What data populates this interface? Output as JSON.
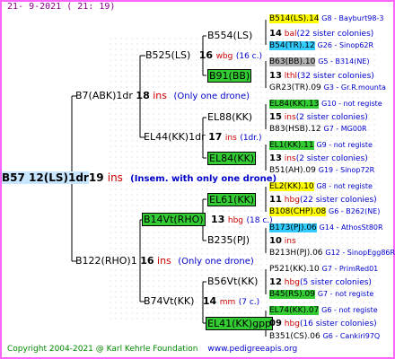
{
  "header": "21-  9-2021 ( 21: 19)",
  "footer": {
    "copyright": "Copyright 2004-2021 @ Karl Kehrle Foundation",
    "url": "www.pedigreeapis.org"
  },
  "colors": {
    "frame": "#ff66ff",
    "green": "#33cc33",
    "yellow": "#ffff00",
    "cyan": "#33ccff",
    "gray": "#b0b0b0",
    "root": "#c8e6ff"
  },
  "root": {
    "name": "B57 12(LS)1dr",
    "num": "19",
    "mark": "ins",
    "note": "(Insem. with only one drone)"
  },
  "parents": [
    {
      "name": "B7(ABK)1dr",
      "num": "18",
      "mark": "ins",
      "note": "(Only one drone)"
    },
    {
      "name": "B122(RHO)1",
      "num": "16",
      "mark": "ins",
      "note": "(Only one drone)"
    }
  ],
  "grandparents": [
    {
      "name": "B525(LS)",
      "num": "16",
      "mark": "wbg",
      "note": "(16 c.)"
    },
    {
      "name": "EL44(KK)1dr",
      "num": "17",
      "mark": "ins",
      "note": "(1dr.)"
    },
    {
      "name": "B14Vt(RHO)",
      "num": "13",
      "mark": "hbg",
      "note": "(18 c.)"
    },
    {
      "name": "B74Vt(KK)",
      "num": "14",
      "mark": "mm",
      "note": "(7 c.)"
    }
  ],
  "ggp": [
    {
      "name": "B554(LS)",
      "num": "14",
      "mark": "bal",
      "note": "(22 sister colonies)"
    },
    {
      "name": "B91(BB)",
      "num": "13",
      "mark": "lthl",
      "note": "(32 sister colonies)"
    },
    {
      "name": "EL88(KK)",
      "num": "15",
      "mark": "ins",
      "note": "(2 sister colonies)"
    },
    {
      "name": "EL84(KK)",
      "num": "13",
      "mark": "ins",
      "note": "(2 sister colonies)"
    },
    {
      "name": "EL61(KK)",
      "num": "11",
      "mark": "hbg",
      "note": "(22 sister colonies)"
    },
    {
      "name": "B235(PJ)",
      "num": "10",
      "mark": "ins",
      "note": ""
    },
    {
      "name": "B56Vt(KK)",
      "num": "12",
      "mark": "hbg",
      "note": "(5 sister colonies)"
    },
    {
      "name": "EL41(KK)gpp",
      "num": "09",
      "mark": "hbg",
      "note": "(16 sister colonies)"
    }
  ],
  "col4": [
    {
      "name": "B514(LS).14",
      "info": "G8 - Bayburt98-3"
    },
    {
      "name": "B54(TR).12",
      "info": "G26 - Sinop62R"
    },
    {
      "name": "B63(BB).10",
      "info": "G5 - B314(NE)"
    },
    {
      "name": "GR23(TR).09",
      "info": "G3 - Gr.R.mounta"
    },
    {
      "name": "EL84(KK).13",
      "info": "G10 - not registe"
    },
    {
      "name": "B83(HSB).12",
      "info": "G7 - MG00R"
    },
    {
      "name": "EL1(KK).11",
      "info": "G9 - not registe"
    },
    {
      "name": "B51(AH).09",
      "info": "G19 - Sinop72R"
    },
    {
      "name": "EL2(KK).10",
      "info": "G8 - not registe"
    },
    {
      "name": "B108(CHP).08",
      "info": "G6 - B262(NE)"
    },
    {
      "name": "B173(PJ).06",
      "info": "G14 - AthosSt80R"
    },
    {
      "name": "B213H(PJ).06",
      "info": "G12 - SinopEgg86R"
    },
    {
      "name": "P521(KK).10",
      "info": "G7 - PrimRed01"
    },
    {
      "name": "B45(RS).09",
      "info": "G7 - not registe"
    },
    {
      "name": "EL74(KK).07",
      "info": "G6 - not registe"
    },
    {
      "name": "B351(CS).06",
      "info": "G6 - Cankiri97Q"
    }
  ]
}
